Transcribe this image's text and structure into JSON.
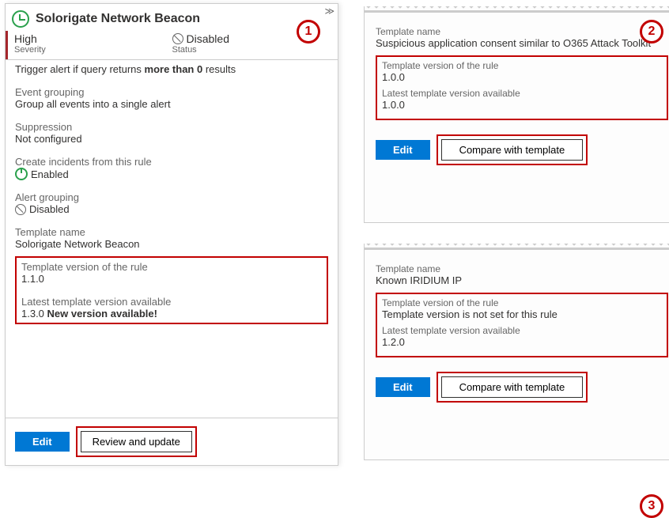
{
  "panel_left": {
    "title": "Solorigate Network Beacon",
    "severity": {
      "value": "High",
      "label": "Severity"
    },
    "status": {
      "value": "Disabled",
      "label": "Status"
    },
    "trigger_prefix": "Trigger alert if query returns ",
    "trigger_bold": "more than 0",
    "trigger_suffix": " results",
    "event_grouping_lbl": "Event grouping",
    "event_grouping_val": "Group all events into a single alert",
    "suppression_lbl": "Suppression",
    "suppression_val": "Not configured",
    "create_incidents_lbl": "Create incidents from this rule",
    "create_incidents_val": "Enabled",
    "alert_grouping_lbl": "Alert grouping",
    "alert_grouping_val": "Disabled",
    "template_name_lbl": "Template name",
    "template_name_val": "Solorigate Network Beacon",
    "tmpl_rule_ver_lbl": "Template version of the rule",
    "tmpl_rule_ver_val": "1.1.0",
    "tmpl_latest_lbl": "Latest template version available",
    "tmpl_latest_val": "1.3.0 ",
    "tmpl_latest_bold": "New version available!",
    "btn_edit": "Edit",
    "btn_review": "Review and update",
    "badge": "1"
  },
  "snippet_a": {
    "template_name_lbl": "Template name",
    "template_name_val": "Suspicious application consent similar to O365 Attack Toolkit",
    "tmpl_rule_ver_lbl": "Template version of the rule",
    "tmpl_rule_ver_val": "1.0.0",
    "tmpl_latest_lbl": "Latest template version available",
    "tmpl_latest_val": "1.0.0",
    "btn_edit": "Edit",
    "btn_compare": "Compare with template",
    "badge": "2"
  },
  "snippet_b": {
    "template_name_lbl": "Template name",
    "template_name_val": "Known IRIDIUM IP",
    "tmpl_rule_ver_lbl": "Template version of the rule",
    "tmpl_rule_ver_val": "Template version is not set for this rule",
    "tmpl_latest_lbl": "Latest template version available",
    "tmpl_latest_val": "1.2.0",
    "btn_edit": "Edit",
    "btn_compare": "Compare with template",
    "badge": "3"
  }
}
